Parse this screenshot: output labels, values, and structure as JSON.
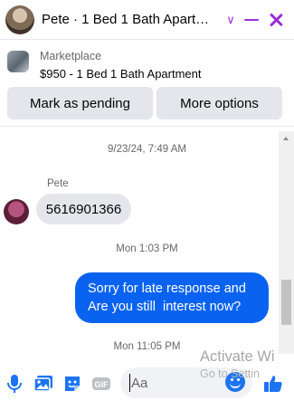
{
  "header": {
    "title": "Pete · 1 Bed 1 Bath Apartment",
    "chevron_icon": "chevron-down-icon",
    "minimize_icon": "minimize-icon",
    "close_icon": "close-icon",
    "accent_color": "#9a2fd8"
  },
  "marketplace": {
    "label": "Marketplace",
    "listing": "$950 - 1 Bed 1 Bath Apartment",
    "buttons": {
      "pending": "Mark as pending",
      "more": "More options"
    }
  },
  "chat": {
    "timestamps": [
      "9/23/24, 7:49 AM",
      "Mon 1:03 PM",
      "Mon 11:05 PM"
    ],
    "sender_name": "Pete",
    "incoming_message": "5616901366",
    "outgoing_message_line1": "Sorry for late response and",
    "outgoing_message_line2": "Are you still  interest now?",
    "outgoing_bubble_color": "#0a63f0"
  },
  "composer": {
    "placeholder": "Aa",
    "icons": [
      "microphone-icon",
      "photo-icon",
      "sticker-icon",
      "gif-icon",
      "emoji-icon",
      "thumbs-up-icon"
    ]
  },
  "watermark": {
    "line1": "Activate Wi",
    "line2": "Go to Settin"
  }
}
